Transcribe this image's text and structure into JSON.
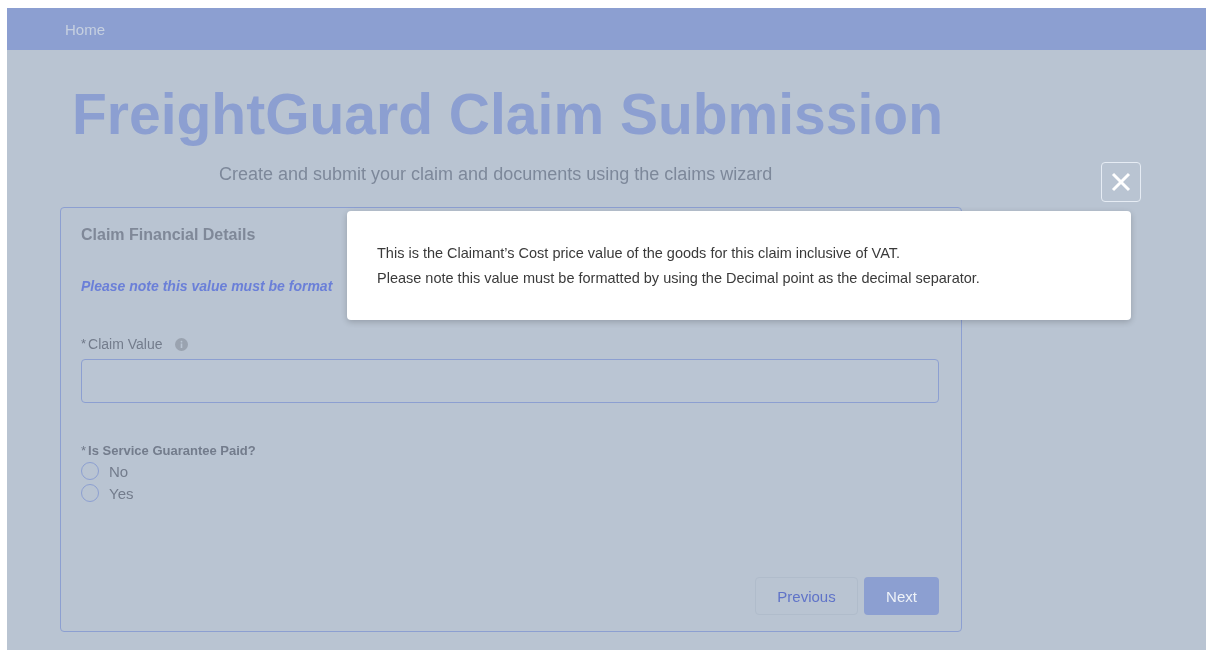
{
  "nav": {
    "items": [
      {
        "label": "Home"
      }
    ]
  },
  "header": {
    "title": "FreightGuard Claim Submission",
    "subtitle": "Create and submit your claim and documents using the claims wizard"
  },
  "card": {
    "title": "Claim Financial Details",
    "note": "Please note this value must be format",
    "fields": [
      {
        "kind": "text",
        "marker": "*",
        "label": "Claim Value",
        "info": true
      },
      {
        "kind": "radio",
        "marker": "*",
        "label": "Is Service Guarantee Paid?",
        "options": [
          {
            "label": "No",
            "selected": false
          },
          {
            "label": "Yes",
            "selected": false
          }
        ]
      }
    ],
    "buttons": [
      {
        "label": "Previous",
        "kind": "secondary"
      },
      {
        "label": "Next",
        "kind": "primary"
      }
    ]
  },
  "popover": {
    "lines": [
      "This is the Claimant’s Cost price value of the goods for this claim inclusive of VAT.",
      "Please note this value must be formatted by using the Decimal point as the decimal separator."
    ]
  }
}
